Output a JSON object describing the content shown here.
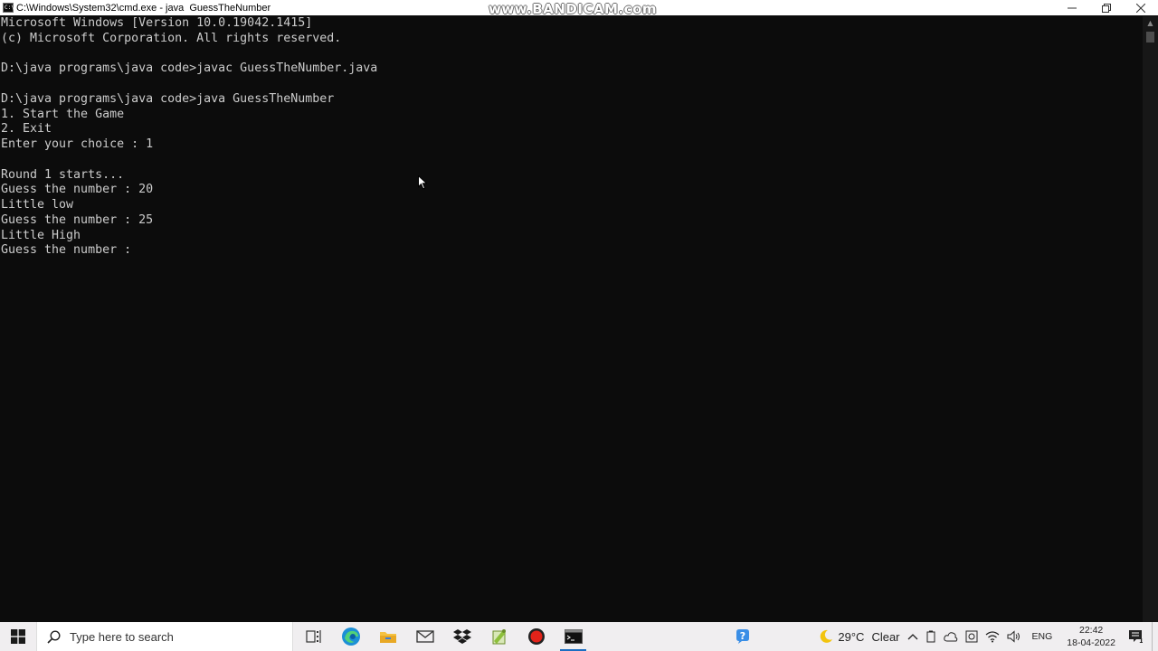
{
  "window": {
    "title": "C:\\Windows\\System32\\cmd.exe - java  GuessTheNumber",
    "watermark": "www.BANDICAM.com",
    "controls": [
      "minimize-icon",
      "restore-icon",
      "close-icon"
    ]
  },
  "console": {
    "lines": [
      "Microsoft Windows [Version 10.0.19042.1415]",
      "(c) Microsoft Corporation. All rights reserved.",
      "",
      "D:\\java programs\\java code>javac GuessTheNumber.java",
      "",
      "D:\\java programs\\java code>java GuessTheNumber",
      "1. Start the Game",
      "2. Exit",
      "Enter your choice : 1",
      "",
      "Round 1 starts...",
      "Guess the number : 20",
      "Little low",
      "Guess the number : 25",
      "Little High",
      "Guess the number : "
    ]
  },
  "taskbar": {
    "search_placeholder": "Type here to search",
    "apps": [
      {
        "name": "task-view-icon"
      },
      {
        "name": "edge-icon"
      },
      {
        "name": "file-explorer-icon"
      },
      {
        "name": "mail-icon"
      },
      {
        "name": "dropbox-icon"
      },
      {
        "name": "notepad-plus-icon"
      },
      {
        "name": "record-icon"
      },
      {
        "name": "command-prompt-icon",
        "active": true
      }
    ],
    "tray": {
      "weather_temp": "29°C",
      "weather_desc": "Clear",
      "language": "ENG",
      "time": "22:42",
      "date": "18-04-2022"
    }
  },
  "colors": {
    "console_bg": "#0c0c0c",
    "console_text": "#cccccc",
    "taskbar_bg": "#f0eef0",
    "accent": "#1b6ec2"
  }
}
